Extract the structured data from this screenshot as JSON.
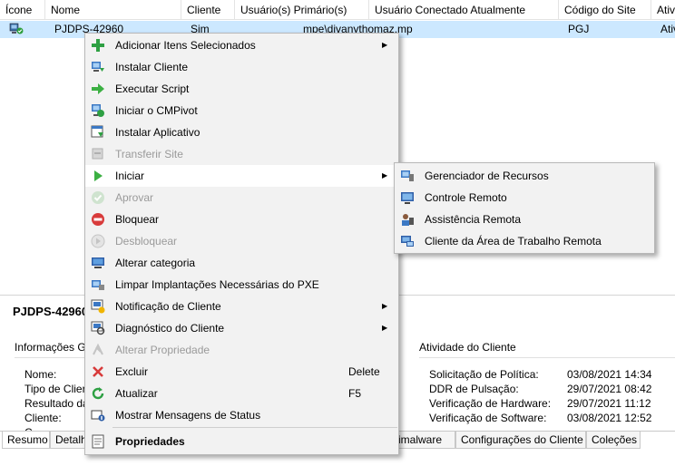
{
  "grid": {
    "columns": [
      "Ícone",
      "Nome",
      "Cliente",
      "Usuário(s) Primário(s)",
      "Usuário Conectado Atualmente",
      "Código do Site",
      "Ativ"
    ],
    "row": {
      "name": "PJDPS-42960",
      "client": "Sim",
      "primary_user": "mpe\\divanythomaz.mp",
      "site_code": "PGJ",
      "active": "Ativ"
    }
  },
  "details": {
    "title": "PJDPS-42960",
    "general_section": "Informações G",
    "general_labels": [
      "Nome:",
      "Tipo de Clier",
      "Resultado da",
      "Cliente:",
      "C"
    ],
    "activity_section": "Atividade do Cliente",
    "activity": [
      {
        "label": "Solicitação de Política:",
        "value": "03/08/2021 14:34"
      },
      {
        "label": "DDR de Pulsação:",
        "value": "29/07/2021 08:42"
      },
      {
        "label": "Verificação de Hardware:",
        "value": "29/07/2021 11:12"
      },
      {
        "label": "Verificação de Software:",
        "value": "03/08/2021 12:52"
      }
    ]
  },
  "tabs": [
    "Resumo",
    "Detalh",
    "ntimalware",
    "Configurações do Cliente",
    "Coleções"
  ],
  "context_menu": {
    "items": [
      {
        "label": "Adicionar Itens Selecionados",
        "icon": "add-icon",
        "submenu": true
      },
      {
        "label": "Instalar Cliente",
        "icon": "install-client-icon"
      },
      {
        "label": "Executar Script",
        "icon": "run-script-icon"
      },
      {
        "label": "Iniciar o CMPivot",
        "icon": "cmpivot-icon"
      },
      {
        "label": "Instalar Aplicativo",
        "icon": "install-app-icon"
      },
      {
        "label": "Transferir Site",
        "icon": "transfer-site-icon",
        "disabled": true
      },
      {
        "label": "Iniciar",
        "icon": "start-icon",
        "submenu": true,
        "hover": true
      },
      {
        "label": "Aprovar",
        "icon": "approve-icon",
        "disabled": true
      },
      {
        "label": "Bloquear",
        "icon": "block-icon"
      },
      {
        "label": "Desbloquear",
        "icon": "unblock-icon",
        "disabled": true
      },
      {
        "label": "Alterar categoria",
        "icon": "change-category-icon"
      },
      {
        "label": "Limpar Implantações Necessárias do PXE",
        "icon": "clear-pxe-icon"
      },
      {
        "label": "Notificação de Cliente",
        "icon": "client-notification-icon",
        "submenu": true
      },
      {
        "label": "Diagnóstico do Cliente",
        "icon": "client-diagnostics-icon",
        "submenu": true
      },
      {
        "label": "Alterar Propriedade",
        "icon": "change-ownership-icon",
        "disabled": true
      },
      {
        "label": "Excluir",
        "icon": "delete-icon",
        "shortcut": "Delete"
      },
      {
        "label": "Atualizar",
        "icon": "refresh-icon",
        "shortcut": "F5"
      },
      {
        "label": "Mostrar Mensagens de Status",
        "icon": "status-messages-icon"
      },
      {
        "label": "Propriedades",
        "icon": "properties-icon",
        "bold": true
      }
    ]
  },
  "submenu": {
    "items": [
      {
        "label": "Gerenciador de Recursos",
        "icon": "resource-explorer-icon"
      },
      {
        "label": "Controle Remoto",
        "icon": "remote-control-icon"
      },
      {
        "label": "Assistência Remota",
        "icon": "remote-assistance-icon"
      },
      {
        "label": "Cliente da Área de Trabalho Remota",
        "icon": "remote-desktop-icon"
      }
    ]
  },
  "colors": {
    "selection": "#cce8ff",
    "menu_bg": "#f2f2f2",
    "disabled_text": "#9a9a9a"
  }
}
